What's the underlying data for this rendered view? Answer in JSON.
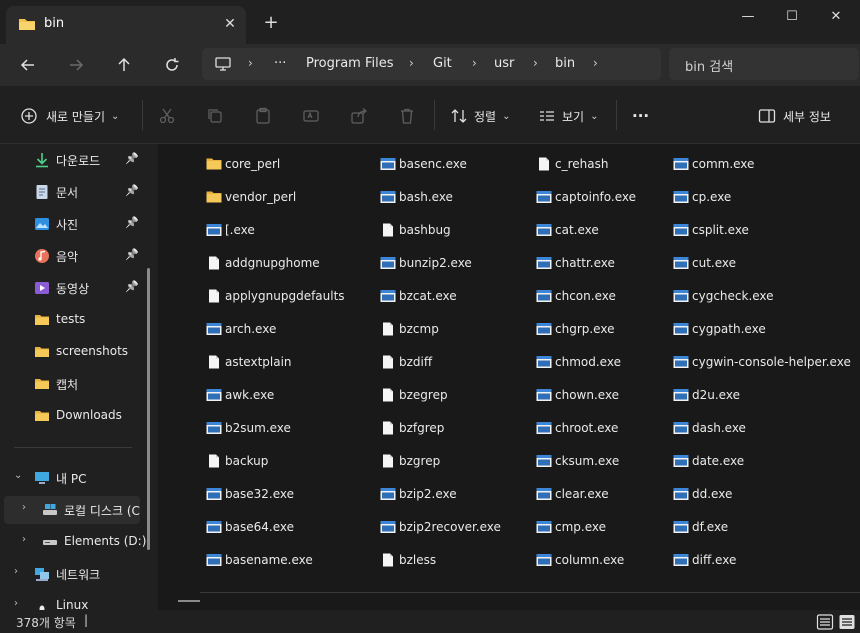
{
  "tab": {
    "title": "bin",
    "close_glyph": "✕",
    "new_tab_glyph": "+"
  },
  "window_controls": {
    "minimize": "—",
    "maximize": "☐",
    "close": "✕"
  },
  "address": {
    "segments": [
      "Program Files",
      "Git",
      "usr",
      "bin"
    ],
    "ellipsis": "···"
  },
  "search": {
    "placeholder": "bin 검색"
  },
  "toolbar": {
    "new_label": "새로 만들기",
    "sort_label": "정렬",
    "view_label": "보기",
    "more_label": "···",
    "details_label": "세부 정보"
  },
  "sidebar": {
    "quick_access": [
      {
        "label": "다운로드",
        "icon": "download-icon",
        "pinned": true
      },
      {
        "label": "문서",
        "icon": "document-icon",
        "pinned": true
      },
      {
        "label": "사진",
        "icon": "pictures-icon",
        "pinned": true
      },
      {
        "label": "음악",
        "icon": "music-icon",
        "pinned": true
      },
      {
        "label": "동영상",
        "icon": "video-icon",
        "pinned": true
      },
      {
        "label": "tests",
        "icon": "folder-icon",
        "pinned": false
      },
      {
        "label": "screenshots",
        "icon": "folder-icon",
        "pinned": false
      },
      {
        "label": "캡처",
        "icon": "folder-icon",
        "pinned": false
      },
      {
        "label": "Downloads",
        "icon": "folder-icon",
        "pinned": false
      }
    ],
    "this_pc": "내 PC",
    "local_disk": "로컬 디스크 (C",
    "elements_drive": "Elements (D:)",
    "network": "네트워크",
    "linux": "Linux"
  },
  "files": [
    [
      "core_perl",
      "vendor_perl",
      "[.exe",
      "addgnupghome",
      "applygnupgdefaults",
      "arch.exe",
      "astextplain",
      "awk.exe",
      "b2sum.exe",
      "backup",
      "base32.exe",
      "base64.exe",
      "basename.exe"
    ],
    [
      "basenc.exe",
      "bash.exe",
      "bashbug",
      "bunzip2.exe",
      "bzcat.exe",
      "bzcmp",
      "bzdiff",
      "bzegrep",
      "bzfgrep",
      "bzgrep",
      "bzip2.exe",
      "bzip2recover.exe",
      "bzless"
    ],
    [
      "c_rehash",
      "captoinfo.exe",
      "cat.exe",
      "chattr.exe",
      "chcon.exe",
      "chgrp.exe",
      "chmod.exe",
      "chown.exe",
      "chroot.exe",
      "cksum.exe",
      "clear.exe",
      "cmp.exe",
      "column.exe"
    ],
    [
      "comm.exe",
      "cp.exe",
      "csplit.exe",
      "cut.exe",
      "cygcheck.exe",
      "cygpath.exe",
      "cygwin-console-helper.exe",
      "d2u.exe",
      "dash.exe",
      "date.exe",
      "dd.exe",
      "df.exe",
      "diff.exe"
    ]
  ],
  "status": {
    "count": "378개 항목"
  },
  "colors": {
    "folder": "#f4c247",
    "exe_frame": "#5aa8e8",
    "background": "#191919"
  }
}
